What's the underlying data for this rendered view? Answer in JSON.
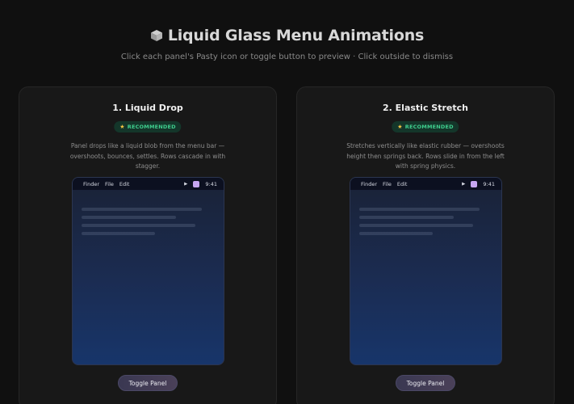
{
  "header": {
    "title": "Liquid Glass Menu Animations",
    "subtitle": "Click each panel's Pasty icon or toggle button to preview · Click outside to dismiss"
  },
  "cards": [
    {
      "title": "1. Liquid Drop",
      "badge": "RECOMMENDED",
      "description": "Panel drops like a liquid blob from the menu bar — overshoots, bounces, settles. Rows cascade in with stagger.",
      "menubar": {
        "items": [
          "Finder",
          "File",
          "Edit"
        ],
        "time": "9:41"
      },
      "button": "Toggle Panel"
    },
    {
      "title": "2. Elastic Stretch",
      "badge": "RECOMMENDED",
      "description": "Stretches vertically like elastic rubber — overshoots height then springs back. Rows slide in from the left with spring physics.",
      "menubar": {
        "items": [
          "Finder",
          "File",
          "Edit"
        ],
        "time": "9:41"
      },
      "button": "Toggle Panel"
    }
  ],
  "colors": {
    "background": "#101010",
    "card": "#181818",
    "badge_bg": "#14362a",
    "badge_text": "#3fcf8e",
    "pasty_icon": "#c7a7f2"
  },
  "icons": {
    "title": "cube-icon",
    "badge": "star-icon",
    "menubar_arrow": "caret-right-icon",
    "menubar_app": "pasty-icon"
  }
}
